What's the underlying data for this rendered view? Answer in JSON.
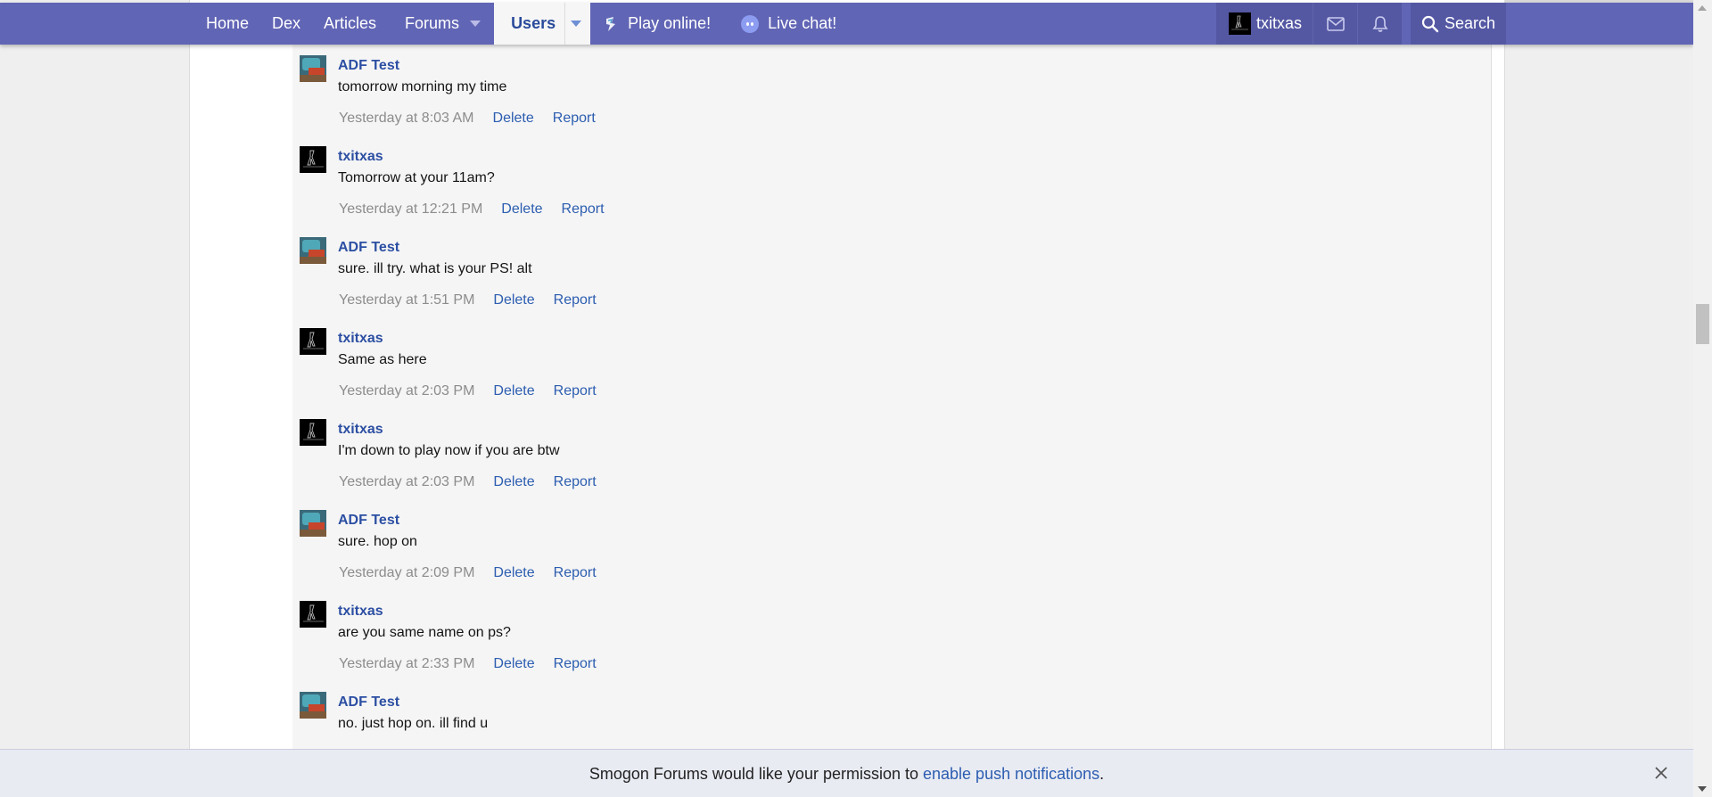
{
  "nav": {
    "items": [
      {
        "label": "Home"
      },
      {
        "label": "Dex"
      },
      {
        "label": "Articles"
      },
      {
        "label": "Forums"
      },
      {
        "label": "Users"
      },
      {
        "label": "Play online!"
      },
      {
        "label": "Live chat!"
      }
    ],
    "username": "txitxas",
    "search_label": "Search"
  },
  "messages": [
    {
      "author": "ADF Test",
      "text": "tomorrow morning my time",
      "time": "Yesterday at 8:03 AM",
      "delete": "Delete",
      "report": "Report",
      "avatar": "adf"
    },
    {
      "author": "txitxas",
      "text": "Tomorrow at your 11am?",
      "time": "Yesterday at 12:21 PM",
      "delete": "Delete",
      "report": "Report",
      "avatar": "txitxas"
    },
    {
      "author": "ADF Test",
      "text": "sure. ill try. what is your PS! alt",
      "time": "Yesterday at 1:51 PM",
      "delete": "Delete",
      "report": "Report",
      "avatar": "adf"
    },
    {
      "author": "txitxas",
      "text": "Same as here",
      "time": "Yesterday at 2:03 PM",
      "delete": "Delete",
      "report": "Report",
      "avatar": "txitxas"
    },
    {
      "author": "txitxas",
      "text": "I'm down to play now if you are btw",
      "time": "Yesterday at 2:03 PM",
      "delete": "Delete",
      "report": "Report",
      "avatar": "txitxas"
    },
    {
      "author": "ADF Test",
      "text": "sure. hop on",
      "time": "Yesterday at 2:09 PM",
      "delete": "Delete",
      "report": "Report",
      "avatar": "adf"
    },
    {
      "author": "txitxas",
      "text": "are you same name on ps?",
      "time": "Yesterday at 2:33 PM",
      "delete": "Delete",
      "report": "Report",
      "avatar": "txitxas"
    },
    {
      "author": "ADF Test",
      "text": "no. just hop on. ill find u",
      "time": "",
      "delete": "",
      "report": "",
      "avatar": "adf"
    }
  ],
  "notice": {
    "prefix": "Smogon Forums would like your permission to ",
    "link": "enable push notifications",
    "suffix": "."
  },
  "icons": {
    "mail": "envelope-icon",
    "alerts": "bell-icon",
    "search": "magnifier-icon",
    "close": "close-icon",
    "play": "showdown-icon",
    "chat": "discord-icon"
  },
  "colors": {
    "nav_bg": "#6165b5",
    "link": "#2c5db0",
    "author": "#2c4fa3"
  }
}
